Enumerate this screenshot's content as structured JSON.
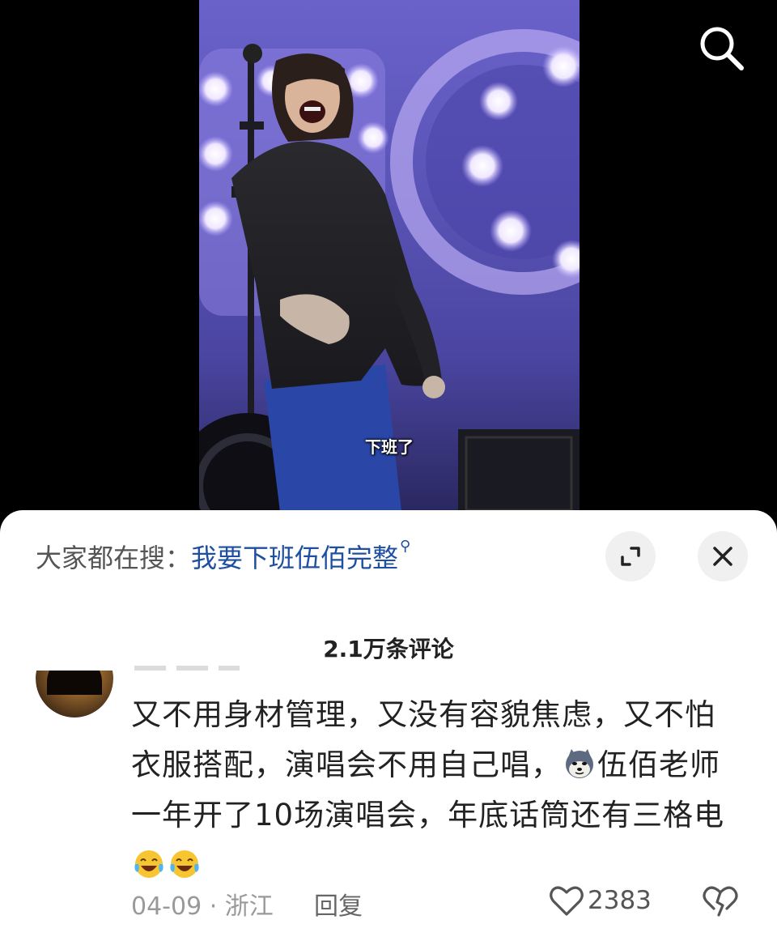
{
  "video": {
    "subtitle": "下班了",
    "search_icon": "search-icon"
  },
  "search_bar": {
    "prefix": "大家都在搜：",
    "query": "我要下班伍佰完整",
    "query_icon": "search-icon"
  },
  "sheet_controls": {
    "expand_icon": "expand-icon",
    "close_icon": "close-icon"
  },
  "comments": {
    "title": "2.1万条评论",
    "items": [
      {
        "text_part1": "又不用身材管理，又没有容貌焦虑，又不怕衣服搭配，演唱会不用自己唱，",
        "emoji1": "doge-emoji",
        "text_part2": "伍佰老师一年开了10场演唱会，年底话筒还有三格电",
        "emoji2": "laugh-cry-emoji",
        "emoji3": "laugh-cry-emoji",
        "date_location": "04-09 · 浙江",
        "reply_label": "回复",
        "like_count": "2383",
        "like_icon": "heart-icon",
        "dislike_icon": "dislike-icon"
      }
    ]
  },
  "colors": {
    "link": "#1e4fa0",
    "stage_purple": "#5b55b8"
  }
}
